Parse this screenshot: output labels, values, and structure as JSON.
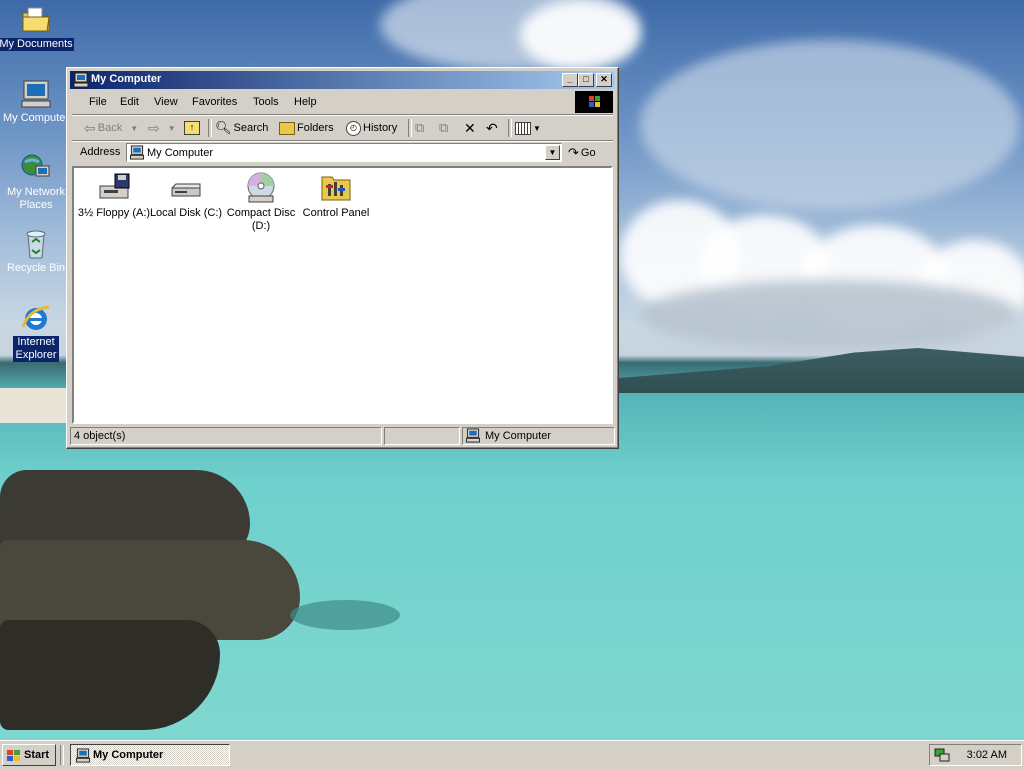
{
  "desktop": {
    "icons": [
      {
        "label": "My Documents",
        "icon": "folder-icon"
      },
      {
        "label": "My Computer",
        "icon": "computer-icon"
      },
      {
        "label": "My Network Places",
        "icon": "network-icon"
      },
      {
        "label": "Recycle Bin",
        "icon": "recycle-bin-icon"
      },
      {
        "label": "Internet Explorer",
        "icon": "internet-explorer-icon"
      }
    ]
  },
  "window": {
    "title": "My Computer",
    "menu": [
      "File",
      "Edit",
      "View",
      "Favorites",
      "Tools",
      "Help"
    ],
    "toolbar": {
      "back": "Back",
      "search": "Search",
      "folders": "Folders",
      "history": "History"
    },
    "address": {
      "label": "Address",
      "value": "My Computer",
      "go": "Go"
    },
    "items": [
      {
        "label": "3½ Floppy (A:)",
        "icon": "floppy-drive-icon"
      },
      {
        "label": "Local Disk (C:)",
        "icon": "hard-disk-icon"
      },
      {
        "label": "Compact Disc (D:)",
        "icon": "cd-drive-icon"
      },
      {
        "label": "Control Panel",
        "icon": "control-panel-icon"
      }
    ],
    "status": {
      "count": "4 object(s)",
      "location": "My Computer"
    }
  },
  "taskbar": {
    "start": "Start",
    "task": "My Computer",
    "clock": "3:02 AM"
  },
  "colors": {
    "titlebar_start": "#0a246a",
    "titlebar_end": "#a6caf0",
    "face": "#d4d0c8",
    "selection": "#0a246a"
  }
}
